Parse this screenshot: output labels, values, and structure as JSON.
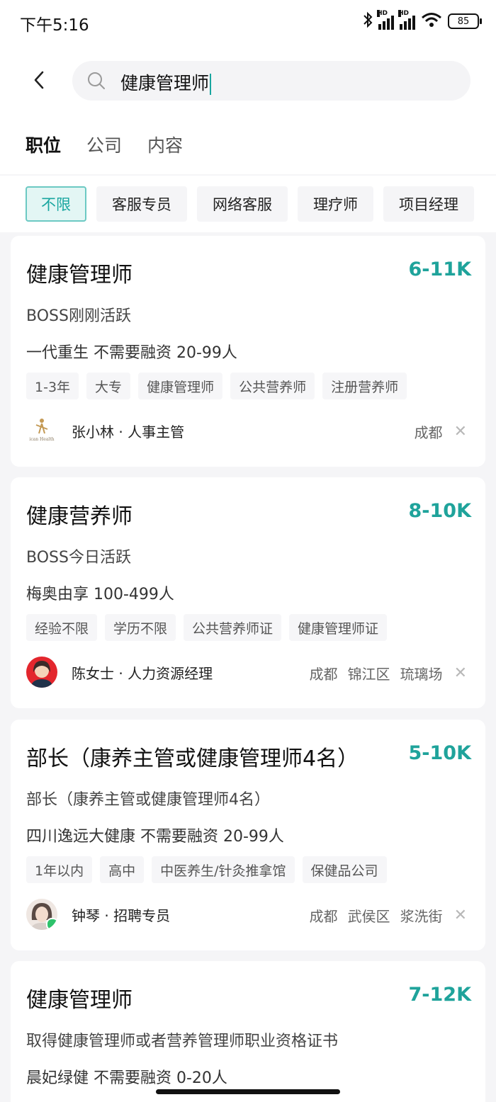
{
  "status_bar": {
    "time": "下午5:16",
    "signal_badge": "HD",
    "battery": "85"
  },
  "search": {
    "query": "健康管理师",
    "icon": "search-icon"
  },
  "tabs": [
    {
      "label": "职位",
      "active": true
    },
    {
      "label": "公司",
      "active": false
    },
    {
      "label": "内容",
      "active": false
    }
  ],
  "filters": [
    {
      "label": "不限",
      "active": true
    },
    {
      "label": "客服专员",
      "active": false
    },
    {
      "label": "网络客服",
      "active": false
    },
    {
      "label": "理疗师",
      "active": false
    },
    {
      "label": "项目经理",
      "active": false
    }
  ],
  "jobs": [
    {
      "title": "健康管理师",
      "salary": "6-11K",
      "subtitle": "BOSS刚刚活跃",
      "company": "一代重生  不需要融资  20-99人",
      "tags": [
        "1-3年",
        "大专",
        "健康管理师",
        "公共营养师",
        "注册营养师"
      ],
      "recruiter": "张小林 · 人事主管",
      "location": [
        "成都"
      ],
      "logo_text": "ican Health"
    },
    {
      "title": "健康营养师",
      "salary": "8-10K",
      "subtitle": "BOSS今日活跃",
      "company": "梅奥由享  100-499人",
      "tags": [
        "经验不限",
        "学历不限",
        "公共营养师证",
        "健康管理师证"
      ],
      "recruiter": "陈女士 · 人力资源经理",
      "location": [
        "成都",
        "锦江区",
        "琉璃场"
      ]
    },
    {
      "title": "部长（康养主管或健康管理师4名）",
      "salary": "5-10K",
      "subtitle": "部长（康养主管或健康管理师4名）",
      "company": "四川逸远大健康  不需要融资  20-99人",
      "tags": [
        "1年以内",
        "高中",
        "中医养生/针灸推拿馆",
        "保健品公司"
      ],
      "recruiter": "钟琴 · 招聘专员",
      "location": [
        "成都",
        "武侯区",
        "浆洗街"
      ]
    },
    {
      "title": "健康管理师",
      "salary": "7-12K",
      "subtitle": "取得健康管理师或者营养管理师职业资格证书",
      "company": "晨妃绿健  不需要融资  0-20人"
    }
  ],
  "colors": {
    "accent": "#1fa39b",
    "page_bg": "#f5f5f7",
    "chip_active_bg": "#e3f6f4"
  }
}
